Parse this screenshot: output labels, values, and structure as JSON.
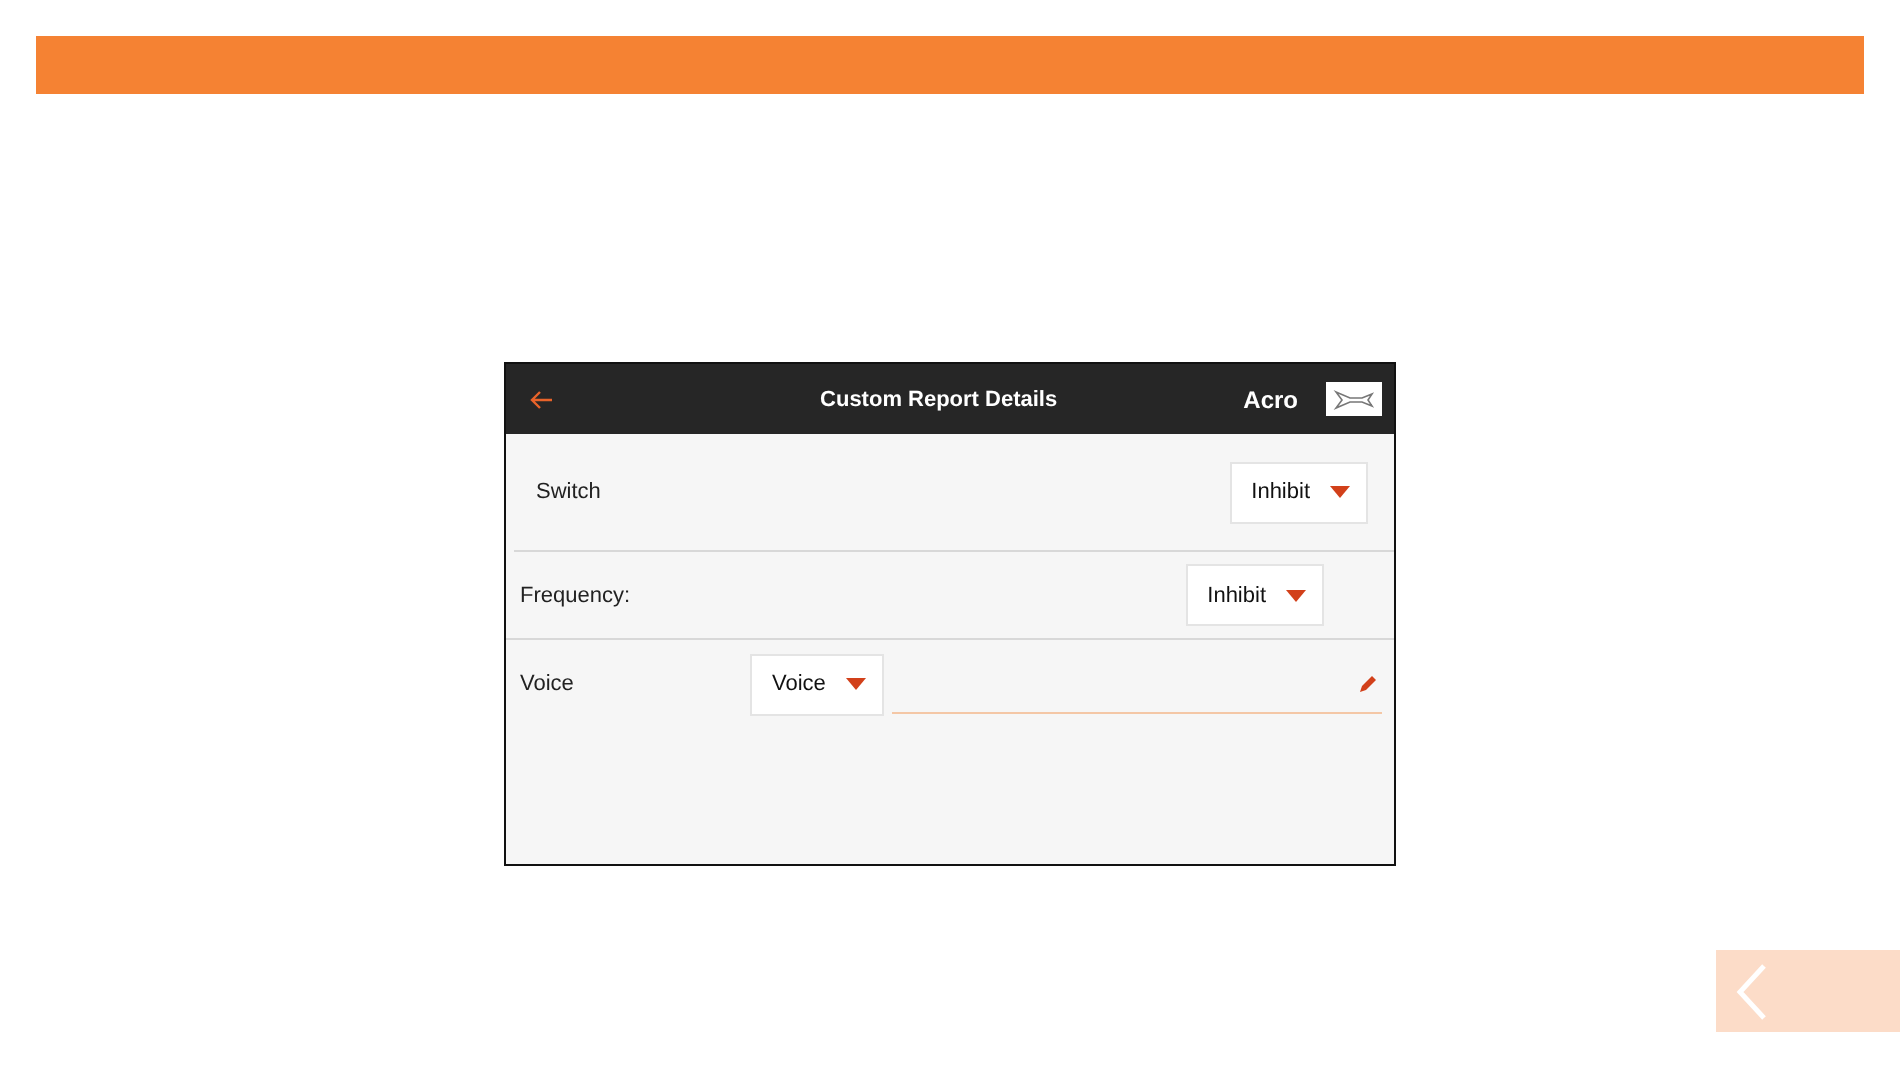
{
  "screen": {
    "title": "Custom Report Details",
    "model": "Acro"
  },
  "rows": [
    {
      "kind": "dropdown",
      "label": "Switch",
      "value": "Inhibit",
      "indented": true
    },
    {
      "kind": "dropdown",
      "label": "Frequency:",
      "value": "Inhibit",
      "indented": false
    },
    {
      "kind": "voice",
      "label": "Voice",
      "value": "Voice",
      "indented": false
    }
  ]
}
